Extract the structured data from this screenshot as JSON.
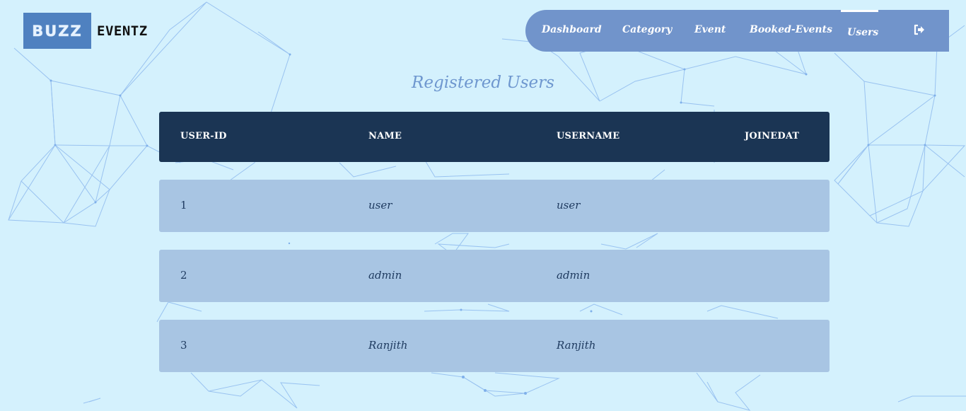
{
  "logo": {
    "box_text": "BUZZ",
    "text": "EVENTZ"
  },
  "nav": {
    "items": [
      {
        "label": "Dashboard"
      },
      {
        "label": "Category"
      },
      {
        "label": "Event"
      },
      {
        "label": "Booked-Events"
      },
      {
        "label": "Users"
      }
    ],
    "active": "Users",
    "logout_icon": "sign-out-icon"
  },
  "page": {
    "title": "Registered Users"
  },
  "table": {
    "columns": [
      "USER-ID",
      "NAME",
      "USERNAME",
      "JOINEDAT"
    ],
    "rows": [
      {
        "id": "1",
        "name": "user",
        "username": "user",
        "joinedat": ""
      },
      {
        "id": "2",
        "name": "admin",
        "username": "admin",
        "joinedat": ""
      },
      {
        "id": "3",
        "name": "Ranjith",
        "username": "Ranjith",
        "joinedat": ""
      }
    ]
  },
  "colors": {
    "background": "#d4f1fd",
    "nav": "#7194cb",
    "logo_box": "#4f81c0",
    "table_header": "#1b3554",
    "table_row": "#a8c5e3",
    "title": "#6e97cf"
  }
}
